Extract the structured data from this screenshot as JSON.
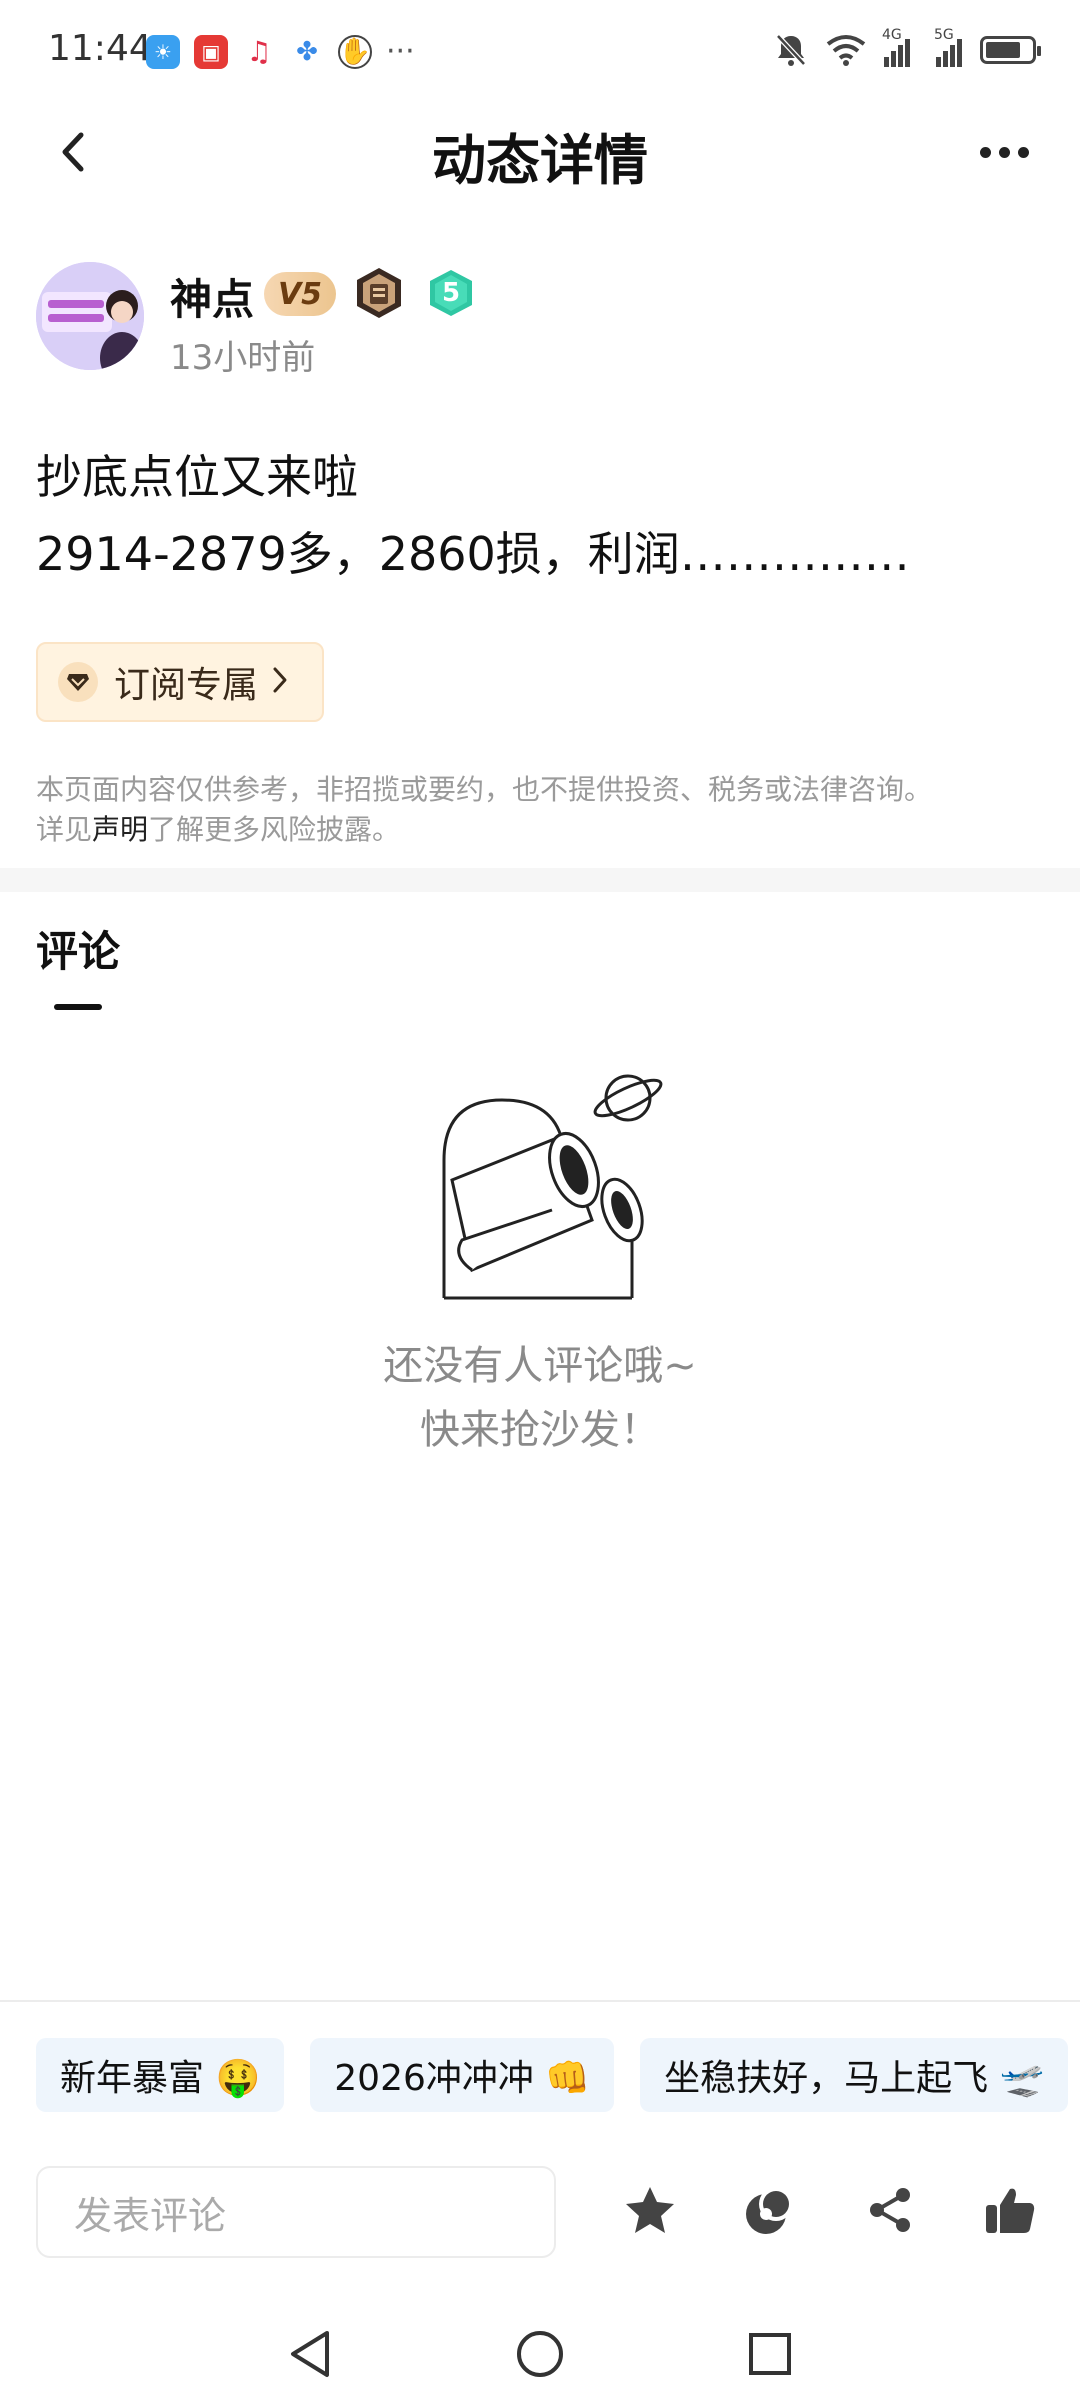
{
  "status_bar": {
    "time": "11:44",
    "extra": "···",
    "network_4g": "4G",
    "network_5g": "5G"
  },
  "header": {
    "title": "动态详情"
  },
  "author": {
    "name": "神点",
    "vip_level": "V5",
    "user_level": "5",
    "time_ago": "13小时前"
  },
  "post": {
    "title": "抄底点位又来啦",
    "body": "2914-2879多，2860损，利润……………"
  },
  "subscribe": {
    "label": "订阅专属"
  },
  "disclaimer": {
    "line1": "本页面内容仅供参考，非招揽或要约，也不提供投资、税务或法律咨询。",
    "prefix": "详见",
    "link": "声明",
    "suffix": "了解更多风险披露。"
  },
  "comments": {
    "title": "评论",
    "empty_line1": "还没有人评论哦~",
    "empty_line2": "快来抢沙发！"
  },
  "quick_tags": [
    "新年暴富 🤑",
    "2026冲冲冲 👊",
    "坐稳扶好，马上起飞 🛫"
  ],
  "comment_input": {
    "placeholder": "发表评论"
  },
  "colors": {
    "accent_vip": "#ecc58f",
    "tag_bg": "#eef5fc",
    "subscribe_bg": "#fff3e0",
    "level_badge": "#2fc7a3"
  }
}
